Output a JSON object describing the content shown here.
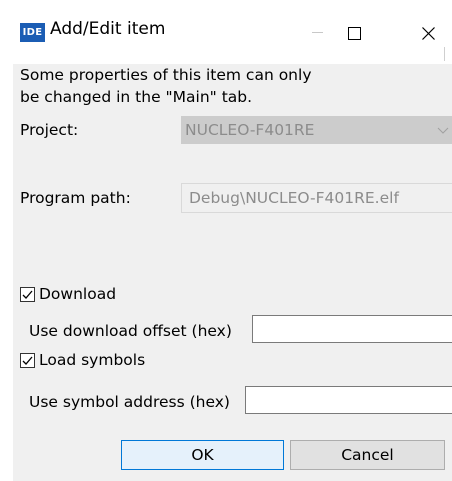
{
  "window": {
    "icon_text": "IDE",
    "title": "Add/Edit item"
  },
  "dialog": {
    "info_line1": "Some properties of this item can only",
    "info_line2": "be changed in the \"Main\" tab.",
    "project_label": "Project:",
    "project_value": "NUCLEO-F401RE",
    "program_path_label": "Program path:",
    "program_path_value": "Debug\\NUCLEO-F401RE.elf",
    "download_label": "Download",
    "download_checked": true,
    "download_offset_label": "Use download offset (hex)",
    "download_offset_value": "",
    "load_symbols_label": "Load symbols",
    "load_symbols_checked": true,
    "symbol_address_label": "Use symbol address (hex)",
    "symbol_address_value": "",
    "ok_label": "OK",
    "cancel_label": "Cancel"
  },
  "colors": {
    "icon_bg": "#1b5db4",
    "client_bg": "#f0f0f0",
    "disabled_text": "#8c8c8c",
    "ok_border": "#0078d7"
  },
  "icons": {
    "minimize": "minimize-icon",
    "maximize": "maximize-icon",
    "close": "close-icon",
    "combo": "chevron-down-icon",
    "check": "checkmark-icon"
  }
}
